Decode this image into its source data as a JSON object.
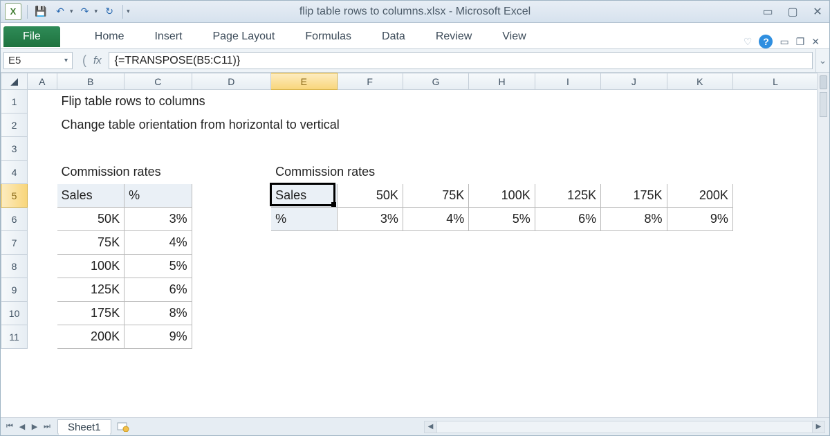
{
  "titlebar": {
    "filename": "flip table rows to columns.xlsx",
    "suffix": " - Microsoft Excel"
  },
  "ribbon": {
    "file": "File",
    "tabs": [
      "Home",
      "Insert",
      "Page Layout",
      "Formulas",
      "Data",
      "Review",
      "View"
    ]
  },
  "formula_bar": {
    "name_box": "E5",
    "fx": "fx",
    "formula": "{=TRANSPOSE(B5:C11)}"
  },
  "columns": [
    "A",
    "B",
    "C",
    "D",
    "E",
    "F",
    "G",
    "H",
    "I",
    "J",
    "K",
    "L"
  ],
  "rows": [
    "1",
    "2",
    "3",
    "4",
    "5",
    "6",
    "7",
    "8",
    "9",
    "10",
    "11"
  ],
  "content": {
    "page_title": "Flip table rows to columns",
    "page_subtitle": "Change table orientation from horizontal to vertical",
    "left_title": "Commission rates",
    "right_title": "Commission rates",
    "left_headers": {
      "sales": "Sales",
      "pct": "%"
    },
    "source_rows": [
      {
        "sales": "50K",
        "pct": "3%"
      },
      {
        "sales": "75K",
        "pct": "4%"
      },
      {
        "sales": "100K",
        "pct": "5%"
      },
      {
        "sales": "125K",
        "pct": "6%"
      },
      {
        "sales": "175K",
        "pct": "8%"
      },
      {
        "sales": "200K",
        "pct": "9%"
      }
    ],
    "transposed": {
      "row1_label": "Sales",
      "row1": [
        "50K",
        "75K",
        "100K",
        "125K",
        "175K",
        "200K"
      ],
      "row2_label": "%",
      "row2": [
        "3%",
        "4%",
        "5%",
        "6%",
        "8%",
        "9%"
      ]
    }
  },
  "sheet_tabs": {
    "active": "Sheet1"
  }
}
